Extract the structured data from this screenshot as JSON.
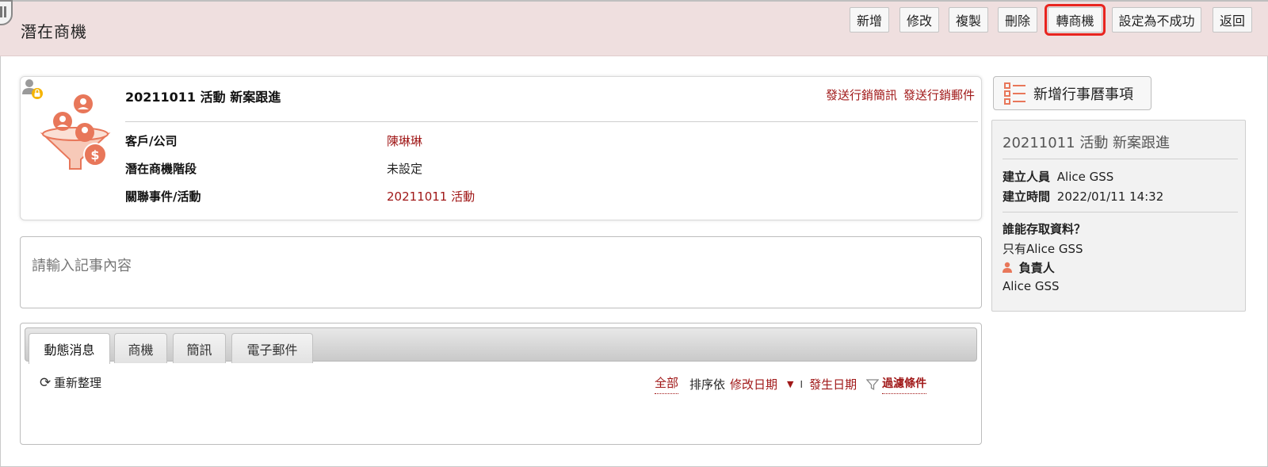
{
  "header": {
    "title": "潛在商機",
    "buttons": {
      "add": "新增",
      "edit": "修改",
      "copy": "複製",
      "delete": "刪除",
      "convert": "轉商機",
      "set_failed": "設定為不成功",
      "back": "返回"
    }
  },
  "record": {
    "title": "20211011 活動 新案跟進",
    "send_sms": "發送行銷簡訊",
    "send_email": "發送行銷郵件",
    "fields": [
      {
        "label": "客戶/公司",
        "value": "陳琳琳"
      },
      {
        "label": "潛在商機階段",
        "value": "未設定"
      },
      {
        "label": "關聯事件/活動",
        "value": "20211011 活動"
      }
    ]
  },
  "note": {
    "placeholder": "請輸入記事內容"
  },
  "activity": {
    "tabs": [
      "動態消息",
      "商機",
      "簡訊",
      "電子郵件"
    ],
    "refresh": "重新整理",
    "all": "全部",
    "sort_by": "排序依",
    "sort_modified": "修改日期",
    "separator": "I",
    "sort_occurred": "發生日期",
    "filter": "過濾條件"
  },
  "side": {
    "add_calendar": "新增行事曆事項",
    "title": "20211011 活動 新案跟進",
    "creator_label": "建立人員",
    "creator": "Alice GSS",
    "created_label": "建立時間",
    "created": "2022/01/11 14:32",
    "access_q": "誰能存取資料？",
    "access_only": "只有Alice GSS",
    "owner_label": "負責人",
    "owner": "Alice GSS"
  },
  "colors": {
    "header_bg": "#efdfdf",
    "link_red": "#a01818",
    "highlight": "#e8241f",
    "accent_orange": "#e8775a"
  }
}
